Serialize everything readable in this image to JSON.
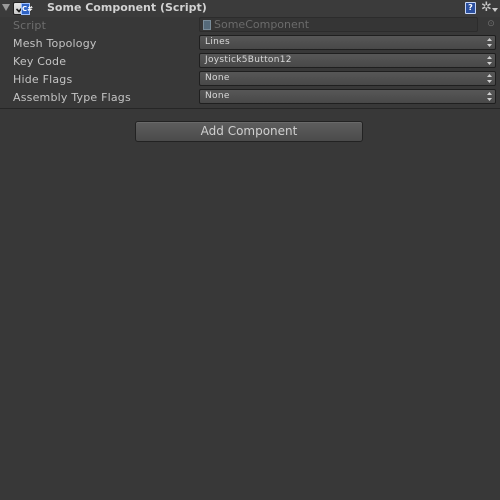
{
  "header": {
    "title": "Some Component (Script)",
    "enabled": true,
    "script_badge": "C#",
    "help_glyph": "?",
    "gear_glyph": "✲"
  },
  "fields": {
    "script": {
      "label": "Script",
      "value": "SomeComponent",
      "picker_glyph": "⊙"
    },
    "mesh_topology": {
      "label": "Mesh Topology",
      "value": "Lines"
    },
    "key_code": {
      "label": "Key Code",
      "value": "Joystick5Button12"
    },
    "hide_flags": {
      "label": "Hide Flags",
      "value": "None"
    },
    "assembly_type_flags": {
      "label": "Assembly Type Flags",
      "value": "None"
    }
  },
  "add_component_label": "Add Component"
}
